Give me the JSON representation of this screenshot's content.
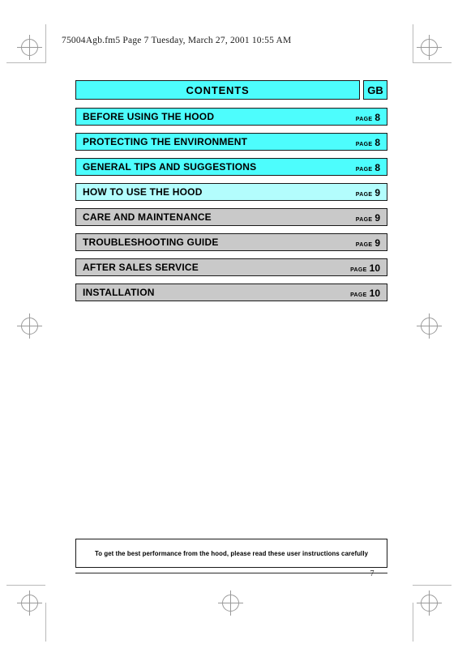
{
  "document": {
    "running_header": "75004Agb.fm5  Page 7  Tuesday, March 27, 2001  10:55 AM",
    "folio": "7"
  },
  "contents": {
    "title": "CONTENTS",
    "language_code": "GB",
    "page_word": "PAGE",
    "rows": [
      {
        "label": "BEFORE USING THE HOOD",
        "page_word": "PAGE",
        "page": "8",
        "fill": "#4dfdfd"
      },
      {
        "label": "PROTECTING THE ENVIRONMENT",
        "page_word": "PAGE",
        "page": "8",
        "fill": "#4dfdfd"
      },
      {
        "label": "GENERAL TIPS AND SUGGESTIONS",
        "page_word": "PAGE",
        "page": "8",
        "fill": "#4dfdfd"
      },
      {
        "label": "HOW TO USE THE HOOD",
        "page_word": "PAGE",
        "page": "9",
        "fill": "#b3fdfd"
      },
      {
        "label": "CARE AND MAINTENANCE",
        "page_word": "PAGE",
        "page": "9",
        "fill": "#c9c9c9"
      },
      {
        "label": "TROUBLESHOOTING GUIDE",
        "page_word": "PAGE",
        "page": "9",
        "fill": "#c9c9c9"
      },
      {
        "label": "AFTER SALES SERVICE",
        "page_word": "PAGE",
        "page": "10",
        "fill": "#c9c9c9"
      },
      {
        "label": "INSTALLATION",
        "page_word": "PAGE",
        "page": "10",
        "fill": "#c9c9c9"
      }
    ]
  },
  "note": {
    "text": "To get the best performance from the hood, please read these user instructions carefully"
  },
  "colors": {
    "accent_cyan": "#4dfdfd",
    "accent_cyan_light": "#b3fdfd",
    "row_gray": "#c9c9c9",
    "border": "#1a1a1a",
    "trim_mark": "#9a9a9a"
  }
}
